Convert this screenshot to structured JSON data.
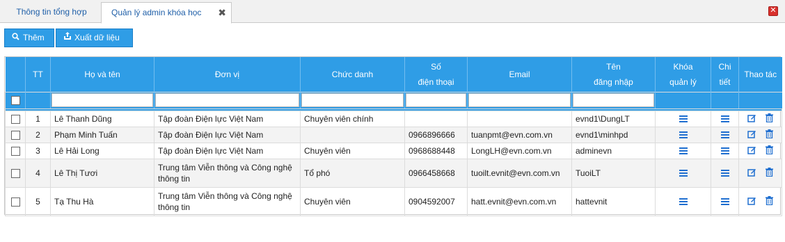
{
  "tabs": [
    {
      "label": "Thông tin tổng hợp",
      "active": false
    },
    {
      "label": "Quản lý admin khóa học",
      "active": true
    }
  ],
  "tab_close_glyph": "✖",
  "window_close_glyph": "✕",
  "toolbar": {
    "add_label": "Thêm",
    "export_label": "Xuất dữ liệu"
  },
  "table": {
    "headers": {
      "tt": "TT",
      "name": "Họ và tên",
      "unit": "Đơn vị",
      "title": "Chức danh",
      "phone_1": "Số",
      "phone_2": "điện thoại",
      "email": "Email",
      "username_1": "Tên",
      "username_2": "đăng nhập",
      "manage_1": "Khóa",
      "manage_2": "quản lý",
      "detail_1": "Chi",
      "detail_2": "tiết",
      "actions": "Thao tác"
    },
    "rows": [
      {
        "tt": "1",
        "name": "Lê Thanh Dũng",
        "unit": "Tập đoàn Điện lực Việt Nam",
        "title": "Chuyên viên chính",
        "phone": "",
        "email": "",
        "username": "evnd1\\DungLT"
      },
      {
        "tt": "2",
        "name": "Phạm Minh Tuấn",
        "unit": "Tập đoàn Điện lực Việt Nam",
        "title": "",
        "phone": "0966896666",
        "email": "tuanpmt@evn.com.vn",
        "username": "evnd1\\minhpd"
      },
      {
        "tt": "3",
        "name": "Lê Hải Long",
        "unit": "Tập đoàn Điện lực Việt Nam",
        "title": "Chuyên viên",
        "phone": "0968688448",
        "email": "LongLH@evn.com.vn",
        "username": "adminevn"
      },
      {
        "tt": "4",
        "name": "Lê Thị Tươi",
        "unit": "Trung tâm Viễn thông và Công nghệ thông tin",
        "title": "Tổ phó",
        "phone": "0966458668",
        "email": "tuoilt.evnit@evn.com.vn",
        "username": "TuoiLT"
      },
      {
        "tt": "5",
        "name": "Tạ Thu Hà",
        "unit": "Trung tâm Viễn thông và Công nghệ thông tin",
        "title": "Chuyên viên",
        "phone": "0904592007",
        "email": "hatt.evnit@evn.com.vn",
        "username": "hattevnit"
      }
    ]
  },
  "colors": {
    "header_blue": "#2f9de6",
    "icon_blue": "#1f6fd0"
  }
}
